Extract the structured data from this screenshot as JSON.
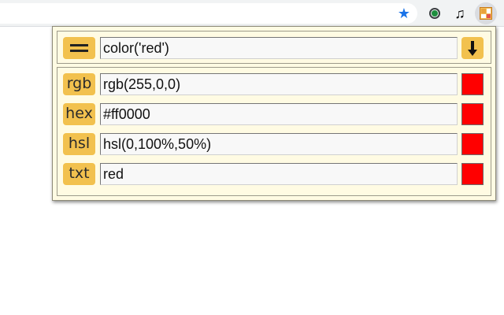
{
  "popup": {
    "expression_value": "color('red')",
    "rows": [
      {
        "label": "rgb",
        "value": "rgb(255,0,0)",
        "swatch_color": "#ff0000"
      },
      {
        "label": "hex",
        "value": "#ff0000",
        "swatch_color": "#ff0000"
      },
      {
        "label": "hsl",
        "value": "hsl(0,100%,50%)",
        "swatch_color": "#ff0000"
      },
      {
        "label": "txt",
        "value": "red",
        "swatch_color": "#ff0000"
      }
    ]
  },
  "toolbar": {
    "icons": [
      "star-icon",
      "green-dot-extension-icon",
      "music-note-icon",
      "color-picker-extension-icon"
    ]
  },
  "colors": {
    "accent": "#f2c14e",
    "popup_background": "#fffbe3",
    "bookmark_star": "#1a73e8"
  }
}
